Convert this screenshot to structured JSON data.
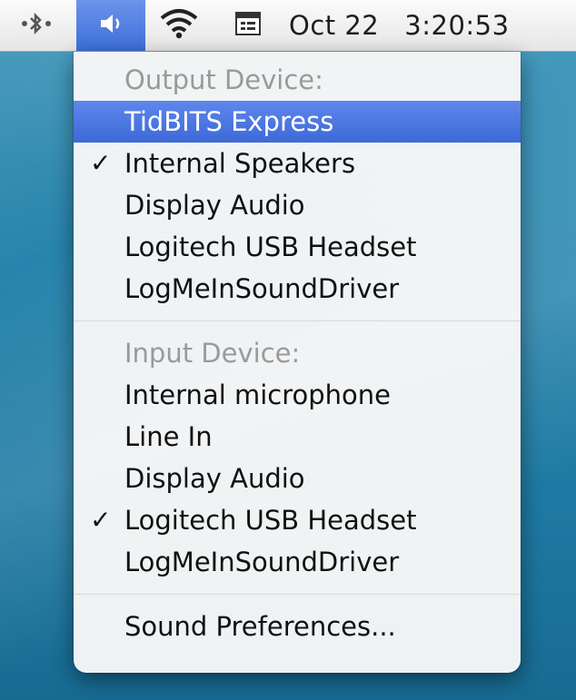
{
  "menubar": {
    "icons": {
      "bluetooth": "bluetooth-icon",
      "volume": "volume-icon",
      "wifi": "wifi-icon",
      "input_menu": "input-menu-icon"
    },
    "date": "Oct 22",
    "time": "3:20:53"
  },
  "menu": {
    "output_header": "Output Device:",
    "output_devices": [
      {
        "label": "TidBITS Express",
        "checked": false,
        "highlighted": true
      },
      {
        "label": "Internal Speakers",
        "checked": true,
        "highlighted": false
      },
      {
        "label": "Display Audio",
        "checked": false,
        "highlighted": false
      },
      {
        "label": "Logitech USB Headset",
        "checked": false,
        "highlighted": false
      },
      {
        "label": "LogMeInSoundDriver",
        "checked": false,
        "highlighted": false
      }
    ],
    "input_header": "Input Device:",
    "input_devices": [
      {
        "label": "Internal microphone",
        "checked": false,
        "highlighted": false
      },
      {
        "label": "Line In",
        "checked": false,
        "highlighted": false
      },
      {
        "label": "Display Audio",
        "checked": false,
        "highlighted": false
      },
      {
        "label": "Logitech USB Headset",
        "checked": true,
        "highlighted": false
      },
      {
        "label": "LogMeInSoundDriver",
        "checked": false,
        "highlighted": false
      }
    ],
    "preferences": "Sound Preferences..."
  },
  "colors": {
    "highlight": "#3d6ad8",
    "header_text": "#9a9a9a",
    "menubar": "#f2f2f2"
  }
}
